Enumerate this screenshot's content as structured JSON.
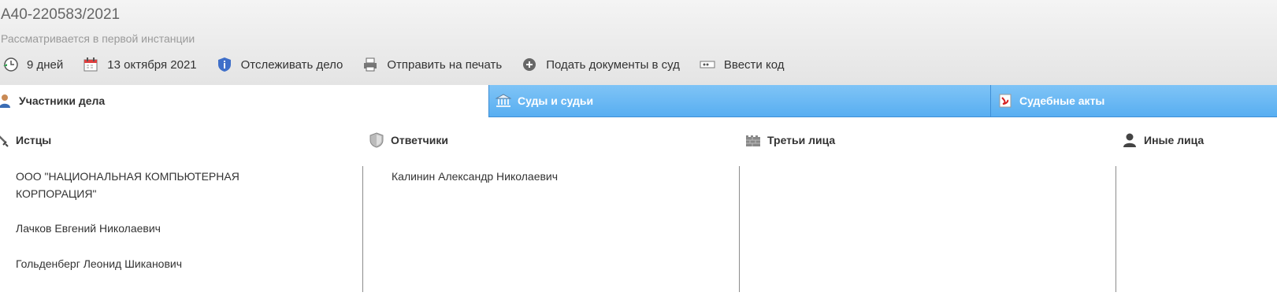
{
  "case": {
    "number": "А40-220583/2021",
    "status": "Рассматривается в первой инстанции"
  },
  "toolbar": {
    "days": "9 дней",
    "date": "13 октября 2021",
    "track": "Отслеживать дело",
    "print": "Отправить на печать",
    "submit": "Подать документы в суд",
    "code": "Ввести код"
  },
  "tabs": {
    "participants": "Участники дела",
    "courts": "Суды и судьи",
    "acts": "Судебные акты"
  },
  "columns": {
    "plaintiffs": {
      "title": "Истцы",
      "items": [
        "ООО \"НАЦИОНАЛЬНАЯ КОМПЬЮТЕРНАЯ КОРПОРАЦИЯ\"",
        "Лачков Евгений Николаевич",
        "Гольденберг Леонид Шиканович"
      ]
    },
    "defendants": {
      "title": "Ответчики",
      "items": [
        "Калинин Александр Николаевич"
      ]
    },
    "third": {
      "title": "Третьи лица"
    },
    "others": {
      "title": "Иные лица"
    }
  },
  "colors": {
    "tab_blue": "#58aef1",
    "header_bg": "#e8e8e8"
  }
}
